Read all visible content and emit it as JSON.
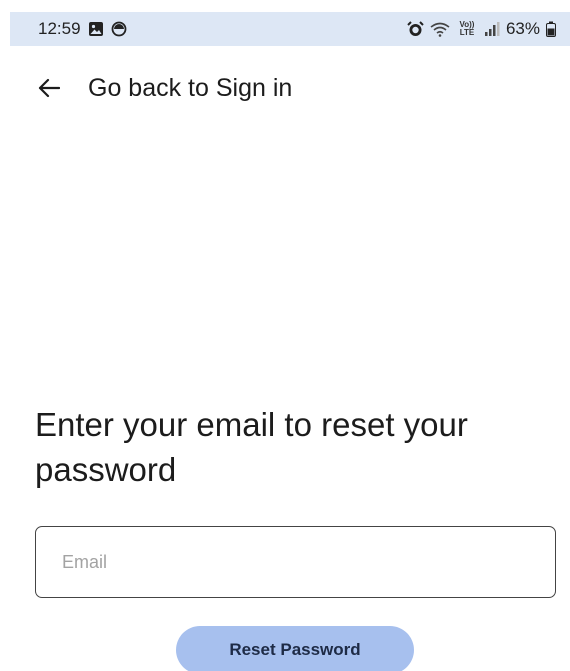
{
  "status_bar": {
    "time": "12:59",
    "battery": "63%",
    "network_label": "Vo)) LTE",
    "icons_left": [
      "gallery-icon",
      "circle-app-icon"
    ],
    "icons_right": [
      "alarm-icon",
      "wifi-icon",
      "volte-lte-icon",
      "signal-icon",
      "battery-icon"
    ],
    "background_color": "#dde7f5"
  },
  "nav": {
    "back_icon": "arrow-left-icon",
    "back_label": "Go back to Sign in"
  },
  "main": {
    "heading": "Enter your email to reset your password",
    "email": {
      "value": "",
      "placeholder": "Email"
    },
    "reset_button_label": "Reset Password",
    "reset_button_color": "#a7c0ee"
  }
}
